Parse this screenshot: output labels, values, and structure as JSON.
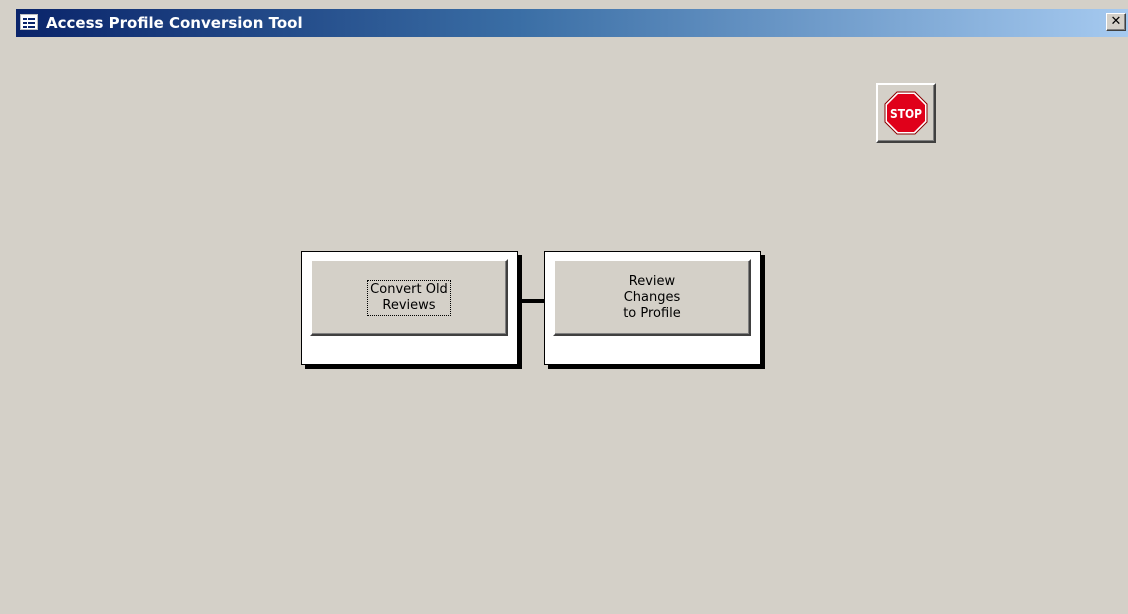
{
  "window": {
    "title": "Access Profile Conversion Tool",
    "close_label": "✕"
  },
  "toolbar": {
    "stop_label": "STOP"
  },
  "main": {
    "convert_button_label": "Convert Old\nReviews",
    "review_button_label": "Review\nChanges\nto Profile"
  },
  "colors": {
    "titlebar_start": "#0a246a",
    "titlebar_end": "#a6caf0",
    "window_background": "#d4d0c8",
    "stop_red": "#e0001a"
  },
  "icons": {
    "app": "form-icon",
    "close": "close-icon",
    "stop": "stop-sign-icon"
  }
}
